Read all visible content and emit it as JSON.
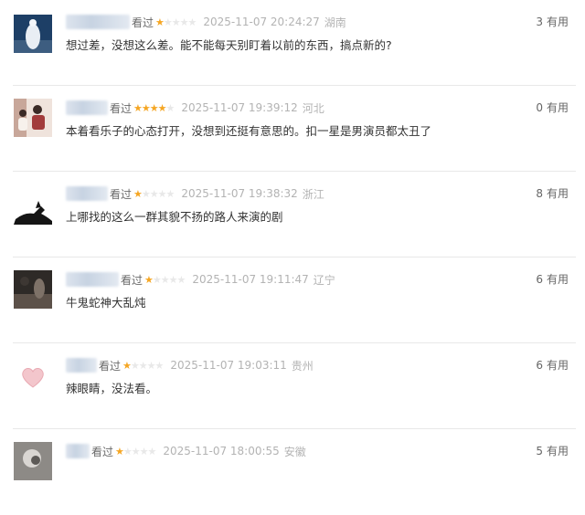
{
  "comments": [
    {
      "status": "看过",
      "rating": 1,
      "time": "2025-11-07 20:24:27",
      "location": "湖南",
      "content": "想过差，没想这么差。能不能每天别盯着以前的东西，搞点新的?",
      "useful_count": "3",
      "useful_label": "有用",
      "avatar_colors": [
        "#1d3f66",
        "#e9eef4",
        "#4f6f93"
      ]
    },
    {
      "status": "看过",
      "rating": 4,
      "time": "2025-11-07 19:39:12",
      "location": "河北",
      "content": "本着看乐子的心态打开，没想到还挺有意思的。扣一星是男演员都太丑了",
      "useful_count": "0",
      "useful_label": "有用",
      "avatar_colors": [
        "#c8a79a",
        "#a23b3b",
        "#f1e6df"
      ]
    },
    {
      "status": "看过",
      "rating": 1,
      "time": "2025-11-07 19:38:32",
      "location": "浙江",
      "content": "上哪找的这么一群其貌不扬的路人来演的剧",
      "useful_count": "8",
      "useful_label": "有用",
      "avatar_colors": [
        "#ffffff",
        "#151515",
        "#2a2a2a"
      ]
    },
    {
      "status": "看过",
      "rating": 1,
      "time": "2025-11-07 19:11:47",
      "location": "辽宁",
      "content": "牛鬼蛇神大乱炖",
      "useful_count": "6",
      "useful_label": "有用",
      "avatar_colors": [
        "#2e2a27",
        "#5c5149",
        "#7e7268"
      ]
    },
    {
      "status": "看过",
      "rating": 1,
      "time": "2025-11-07 19:03:11",
      "location": "贵州",
      "content": "辣眼睛，没法看。",
      "useful_count": "6",
      "useful_label": "有用",
      "avatar_colors": [
        "#ffffff",
        "#f3c6cc",
        "#e9aab3"
      ]
    },
    {
      "status": "看过",
      "rating": 1,
      "time": "2025-11-07 18:00:55",
      "location": "安徽",
      "content": "",
      "useful_count": "5",
      "useful_label": "有用",
      "avatar_colors": [
        "#8d8a86",
        "#d9d6d2",
        "#5d5a57"
      ]
    }
  ],
  "accent_colors": {
    "star_on": "#f5a623",
    "star_off": "#e8e8e8",
    "meta": "#b3b3b3"
  }
}
